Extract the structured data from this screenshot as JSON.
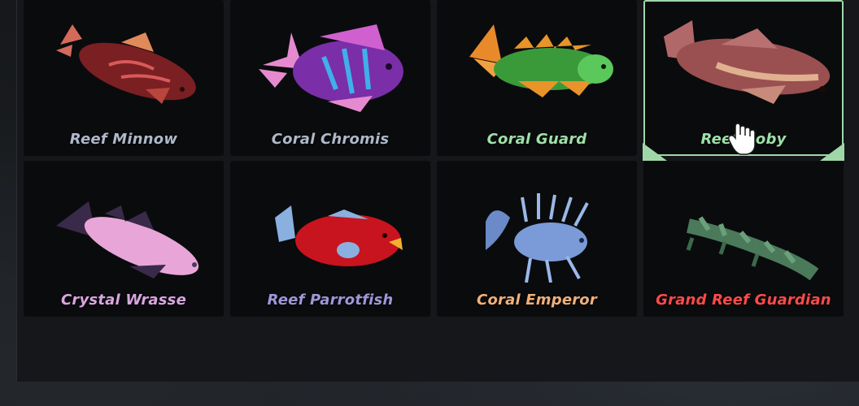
{
  "fish_grid": {
    "items": [
      {
        "name": "Reef Minnow",
        "name_color": "#aeb8c8",
        "art": "reef-minnow-icon"
      },
      {
        "name": "Coral Chromis",
        "name_color": "#aeb8c8",
        "art": "coral-chromis-icon"
      },
      {
        "name": "Coral Guard",
        "name_color": "#9fe0a8",
        "art": "coral-guard-icon"
      },
      {
        "name": "Reef Goby",
        "name_color": "#9fe0a8",
        "art": "reef-goby-icon",
        "selected": true
      },
      {
        "name": "Crystal Wrasse",
        "name_color": "#d9a6e0",
        "art": "crystal-wrasse-icon"
      },
      {
        "name": "Reef Parrotfish",
        "name_color": "#9f96d8",
        "art": "reef-parrotfish-icon"
      },
      {
        "name": "Coral Emperor",
        "name_color": "#f0b07a",
        "art": "coral-emperor-icon"
      },
      {
        "name": "Grand Reef Guardian",
        "name_color": "#ff4a4a",
        "art": "grand-reef-guardian-icon"
      }
    ]
  },
  "colors": {
    "selection_outline": "#9fd8a8",
    "cell_background": "#0a0b0d"
  }
}
